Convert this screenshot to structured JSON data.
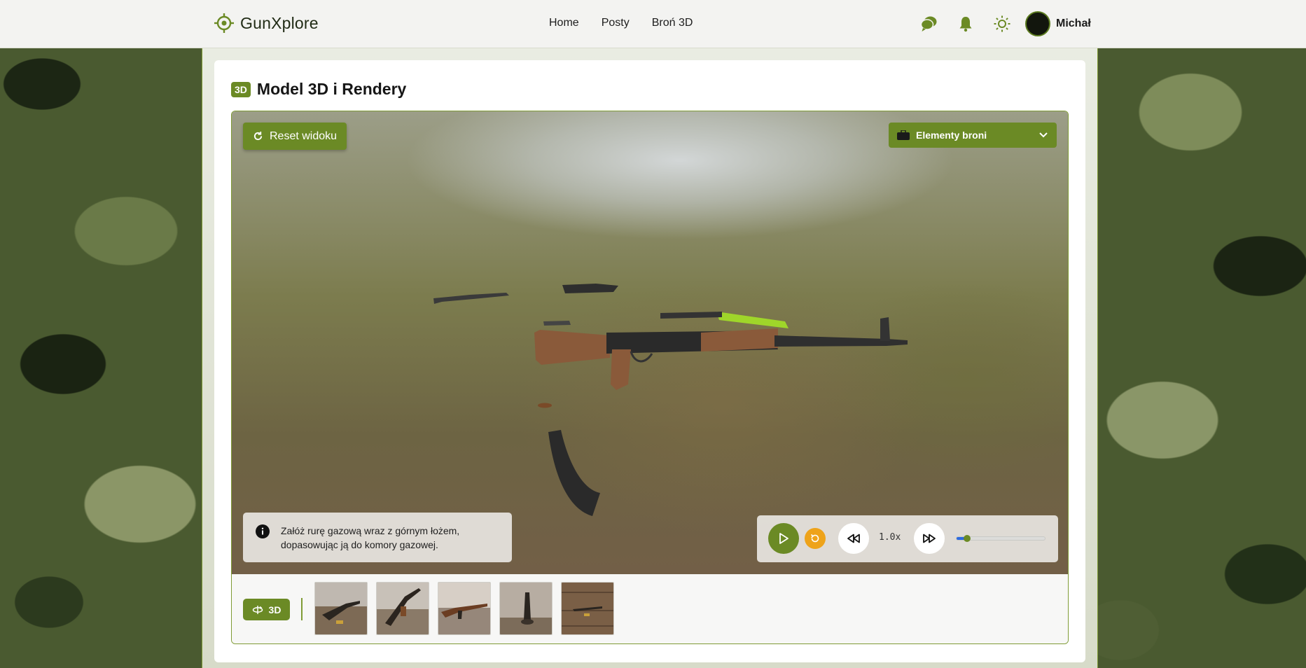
{
  "header": {
    "brand": "GunXplore",
    "nav": [
      "Home",
      "Posty",
      "Broń 3D"
    ],
    "icons": [
      "chat-icon",
      "bell-icon",
      "sun-icon"
    ],
    "user_name": "Michał",
    "accent_color": "#6b8a25"
  },
  "section": {
    "badge": "3D",
    "title": "Model 3D i Rendery"
  },
  "viewer": {
    "reset_label": "Reset widoku",
    "parts_dropdown_label": "Elementy broni",
    "instruction_line1": "Załóż rurę gazową wraz z górnym łożem,",
    "instruction_line2": "dopasowując ją do komory gazowej.",
    "speed": "1.0x",
    "progress_fraction": 0.12,
    "progress_color": "#2d6be0",
    "restart_color": "#eea31a"
  },
  "thumbnails": {
    "mode_label": "3D",
    "items": [
      "render-1",
      "render-2",
      "render-3",
      "render-4",
      "render-5"
    ]
  }
}
